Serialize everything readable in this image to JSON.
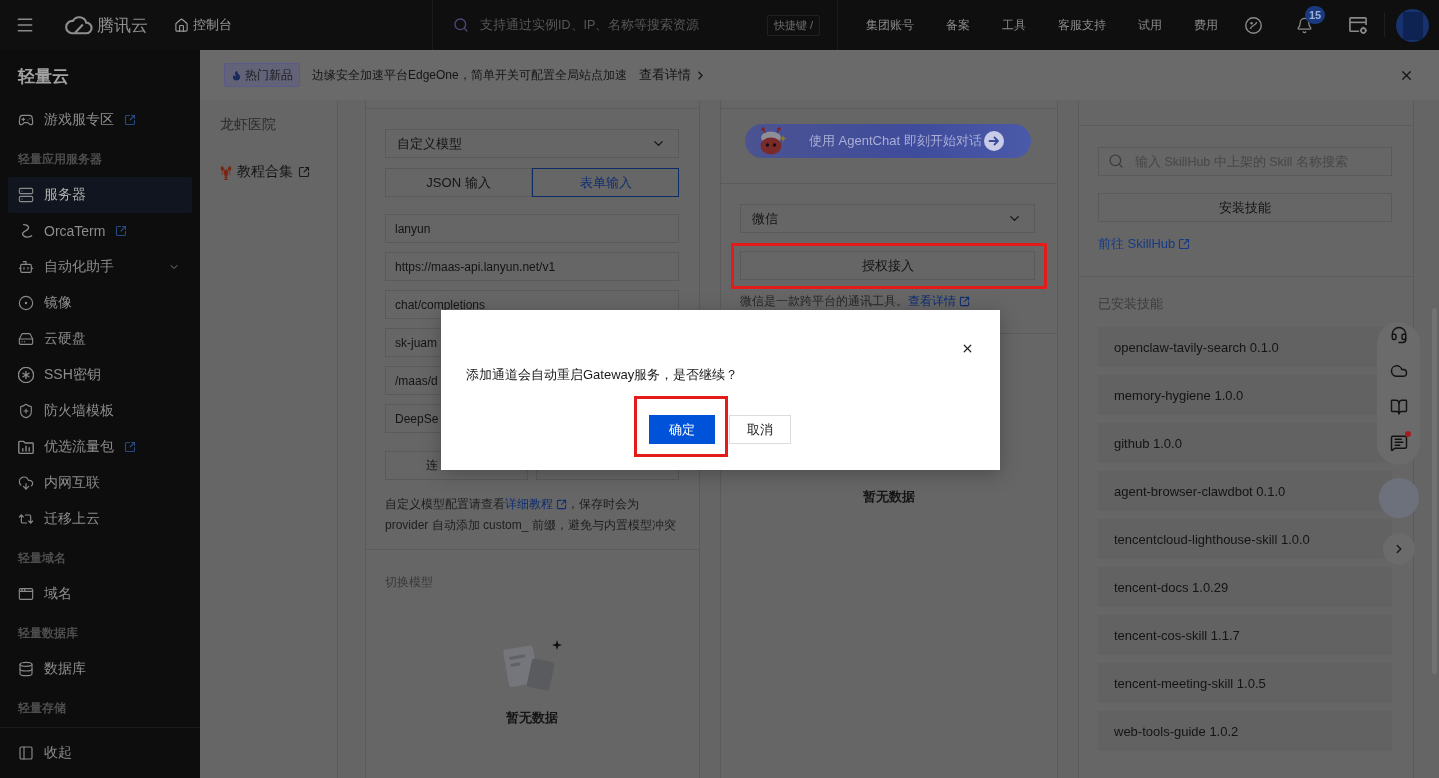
{
  "top_bar": {
    "logo": "腾讯云",
    "console": "控制台",
    "search": {
      "placeholder": "支持通过实例ID、IP、名称等搜索资源"
    },
    "shortcut": "快捷键 /",
    "nav": [
      "集团账号",
      "备案",
      "工具",
      "客服支持",
      "试用",
      "费用"
    ],
    "notification_count": "15"
  },
  "sidebar": {
    "title": "轻量云",
    "items": [
      {
        "kind": "external",
        "label": "游戏服专区",
        "selected": false
      },
      {
        "kind": "group",
        "label": "轻量应用服务器"
      },
      {
        "kind": "item",
        "label": "服务器",
        "selected": true
      },
      {
        "kind": "external",
        "label": "OrcaTerm",
        "selected": false
      },
      {
        "kind": "submenu",
        "label": "自动化助手",
        "selected": false,
        "expanded": false
      },
      {
        "kind": "item",
        "label": "镜像",
        "selected": false
      },
      {
        "kind": "item",
        "label": "云硬盘",
        "selected": false
      },
      {
        "kind": "item",
        "label": "SSH密钥",
        "selected": false
      },
      {
        "kind": "item",
        "label": "防火墙模板",
        "selected": false
      },
      {
        "kind": "external",
        "label": "优选流量包",
        "selected": false
      },
      {
        "kind": "item",
        "label": "内网互联",
        "selected": false
      },
      {
        "kind": "item",
        "label": "迁移上云",
        "selected": false
      },
      {
        "kind": "group",
        "label": "轻量域名"
      },
      {
        "kind": "item",
        "label": "域名",
        "selected": false
      },
      {
        "kind": "group",
        "label": "轻量数据库"
      },
      {
        "kind": "item",
        "label": "数据库",
        "selected": false
      },
      {
        "kind": "group",
        "label": "轻量存储"
      }
    ],
    "collapse": "收起"
  },
  "banner": {
    "tag": "热门新品",
    "text": "边缘安全加速平台EdgeOne，简单开关可配置全局站点加速",
    "link": "查看详情"
  },
  "subnav": [
    {
      "kind": "item",
      "label": "龙虾医院"
    },
    {
      "kind": "external",
      "label": "教程合集"
    }
  ],
  "model_panel": {
    "provider": "自定义模型",
    "input_modes": [
      {
        "label": "JSON 输入",
        "selected": false
      },
      {
        "label": "表单输入",
        "selected": true
      }
    ],
    "fields": [
      "lanyun",
      "https://maas-api.lanyun.net/v1",
      "chat/completions",
      "sk-juam",
      "/maas/d",
      "DeepSe"
    ],
    "actions": [
      {
        "kind": "labeled",
        "label": "连"
      },
      {
        "kind": "blank"
      }
    ],
    "note": {
      "before": "自定义模型配置请查看",
      "link": "详细教程",
      "after": "，保存时会为 provider 自动添加 custom_ 前缀，避免与内置模型冲突"
    },
    "switch_label": "切换模型",
    "empty_text": "暂无数据"
  },
  "channel_panel": {
    "agentchat": "使用 AgentChat 即刻开始对话",
    "channel": "微信",
    "authorize": {
      "label": "授权接入",
      "highlighted": true
    },
    "description": "微信是一款跨平台的通讯工具。",
    "link": "查看详情",
    "empty_text": "暂无数据"
  },
  "skills_panel": {
    "search": {
      "placeholder": "输入 SkillHub 中上架的 Skill 名称搜索"
    },
    "install": "安装技能",
    "hub_link": "前往 SkillHub",
    "installed_label": "已安装技能",
    "installed": [
      "openclaw-tavily-search 0.1.0",
      "memory-hygiene 1.0.0",
      "github 1.0.0",
      "agent-browser-clawdbot 0.1.0",
      "tencentcloud-lighthouse-skill 1.0.0",
      "tencent-docs 1.0.29",
      "tencent-cos-skill 1.1.7",
      "tencent-meeting-skill 1.0.5",
      "web-tools-guide 1.0.2"
    ]
  },
  "float_tools": [
    {
      "kind": "support",
      "unread": false
    },
    {
      "kind": "cloud",
      "unread": false
    },
    {
      "kind": "docs",
      "unread": false
    },
    {
      "kind": "feedback",
      "unread": true
    }
  ],
  "dialog": {
    "message": "添加通道会自动重启Gateway服务，是否继续？",
    "buttons": [
      {
        "kind": "primary",
        "label": "确定",
        "highlighted": true
      },
      {
        "kind": "secondary",
        "label": "取消",
        "highlighted": false
      }
    ]
  }
}
